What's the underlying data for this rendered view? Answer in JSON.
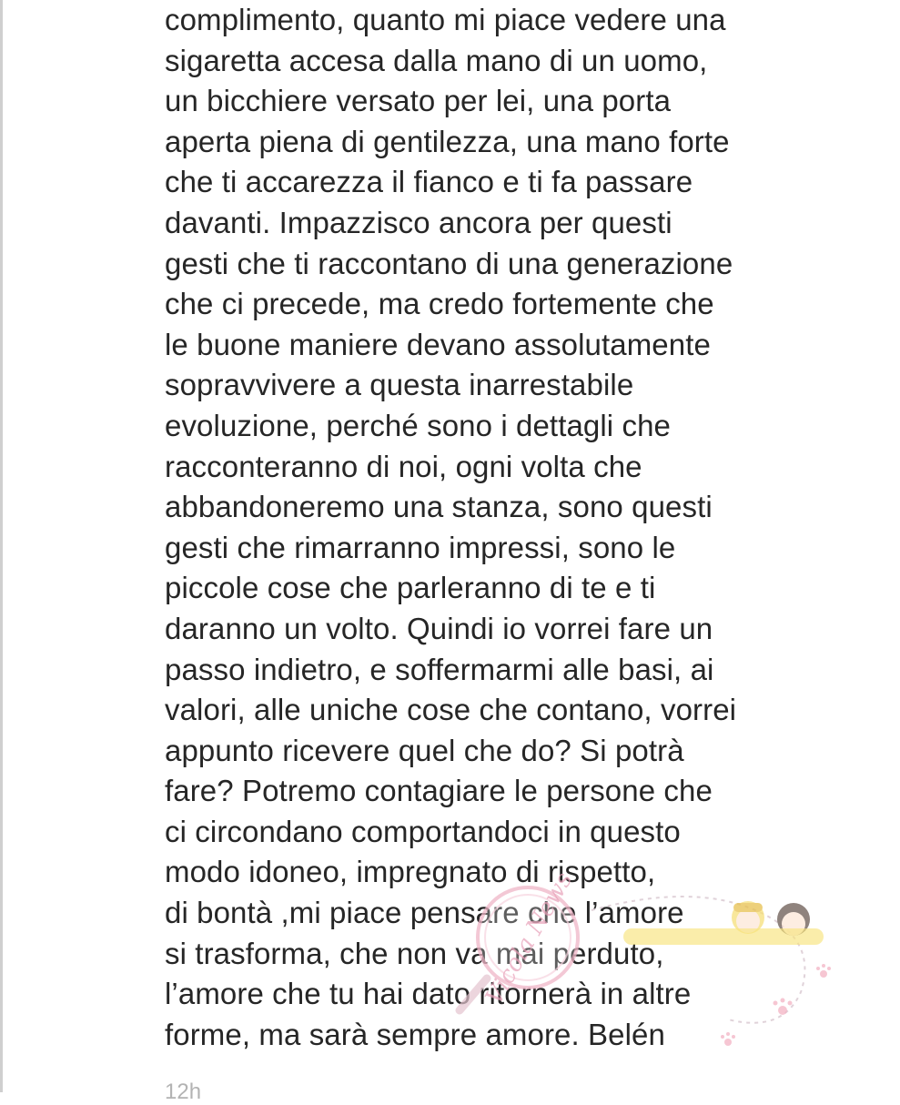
{
  "comment": {
    "lines": [
      "complimento, quanto mi piace vedere una",
      "sigaretta accesa dalla mano di un uomo,",
      "un bicchiere versato per lei, una porta",
      "aperta piena di gentilezza, una mano forte",
      "che ti accarezza il fianco e ti fa passare",
      "davanti. Impazzisco ancora per questi",
      "gesti che ti raccontano di una generazione",
      "che ci precede, ma credo fortemente che",
      "le buone maniere devano assolutamente",
      "sopravvivere a questa inarrestabile",
      "evoluzione, perché sono i dettagli che",
      "racconteranno di noi, ogni volta che",
      "abbandoneremo una stanza, sono questi",
      "gesti che rimarranno impressi, sono le",
      "piccole cose che parleranno di te e ti",
      "daranno un volto. Quindi io vorrei fare un",
      "passo indietro, e soffermarmi alle basi, ai",
      "valori, alle uniche cose che contano, vorrei",
      "appunto ricevere quel che do? Si potrà",
      "fare? Potremo contagiare le persone che",
      "ci circondano comportandoci in questo",
      "modo idoneo, impregnato di rispetto,",
      "di bontà ,mi piace pensare che l’amore",
      "si trasforma, che non va mai perduto,",
      "l’amore che tu hai dato ritornerà in altre",
      "forme, ma sarà sempre amore. Belén"
    ],
    "timestamp": "12h"
  },
  "watermark": {
    "text": "Vicola News",
    "color": "#e8a0b8"
  }
}
